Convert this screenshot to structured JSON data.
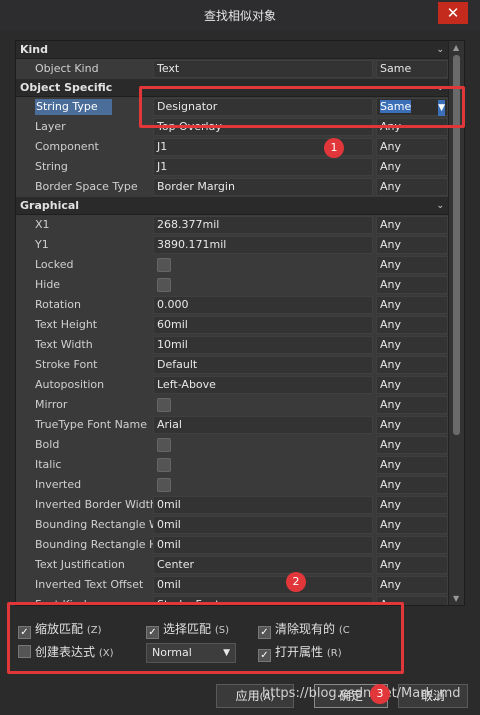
{
  "window": {
    "title": "查找相似对象",
    "close_glyph": "✕"
  },
  "sections": {
    "kind": "Kind",
    "object_specific": "Object Specific",
    "graphical": "Graphical",
    "collapse_glyph": "⌄"
  },
  "rows_kind": [
    {
      "name": "Object Kind",
      "value": "Text",
      "mode": "Same"
    }
  ],
  "rows_object": [
    {
      "name": "String Type",
      "value": "Designator",
      "mode": "Same"
    },
    {
      "name": "Layer",
      "value": "Top Overlay",
      "mode": "Any"
    },
    {
      "name": "Component",
      "value": "J1",
      "mode": "Any"
    },
    {
      "name": "String",
      "value": "J1",
      "mode": "Any"
    },
    {
      "name": "Border Space Type",
      "value": "Border Margin",
      "mode": "Any"
    }
  ],
  "rows_graphical": [
    {
      "name": "X1",
      "value": "268.377mil",
      "mode": "Any"
    },
    {
      "name": "Y1",
      "value": "3890.171mil",
      "mode": "Any"
    },
    {
      "name": "Locked",
      "value": "",
      "checkbox": true,
      "mode": "Any"
    },
    {
      "name": "Hide",
      "value": "",
      "checkbox": true,
      "mode": "Any"
    },
    {
      "name": "Rotation",
      "value": "0.000",
      "mode": "Any"
    },
    {
      "name": "Text Height",
      "value": "60mil",
      "mode": "Any"
    },
    {
      "name": "Text Width",
      "value": "10mil",
      "mode": "Any"
    },
    {
      "name": "Stroke Font",
      "value": "Default",
      "mode": "Any"
    },
    {
      "name": "Autoposition",
      "value": "Left-Above",
      "mode": "Any"
    },
    {
      "name": "Mirror",
      "value": "",
      "checkbox": true,
      "mode": "Any"
    },
    {
      "name": "TrueType Font Name",
      "value": "Arial",
      "mode": "Any"
    },
    {
      "name": "Bold",
      "value": "",
      "checkbox": true,
      "mode": "Any"
    },
    {
      "name": "Italic",
      "value": "",
      "checkbox": true,
      "mode": "Any"
    },
    {
      "name": "Inverted",
      "value": "",
      "checkbox": true,
      "mode": "Any"
    },
    {
      "name": "Inverted Border Width",
      "value": "0mil",
      "mode": "Any"
    },
    {
      "name": "Bounding Rectangle W",
      "value": "0mil",
      "mode": "Any"
    },
    {
      "name": "Bounding Rectangle H",
      "value": "0mil",
      "mode": "Any"
    },
    {
      "name": "Text Justification",
      "value": "Center",
      "mode": "Any"
    },
    {
      "name": "Inverted Text Offset",
      "value": "0mil",
      "mode": "Any"
    },
    {
      "name": "Font Kind",
      "value": "Stroke Font",
      "mode": "Any"
    }
  ],
  "options": {
    "zoom_match": {
      "label": "缩放匹配",
      "hotkey": "(Z)",
      "checked": true
    },
    "select_match": {
      "label": "选择匹配",
      "hotkey": "(S)",
      "checked": true
    },
    "clear_existing": {
      "label": "清除现有的",
      "hotkey": "(C",
      "checked": true
    },
    "create_expression": {
      "label": "创建表达式",
      "hotkey": "(X)",
      "checked": false
    },
    "open_properties": {
      "label": "打开属性",
      "hotkey": "(R)",
      "checked": true
    },
    "mask_mode": "Normal"
  },
  "buttons": {
    "apply": "应用",
    "apply_hk": "(A)",
    "ok": "确定",
    "cancel": "取消"
  },
  "annotations": {
    "badge1": "1",
    "badge2": "2",
    "badge3": "3"
  },
  "watermark": "https://blog.csdn.net/Mark_md",
  "colors": {
    "highlight": "#e2373a",
    "selection": "#3b6fb8"
  }
}
